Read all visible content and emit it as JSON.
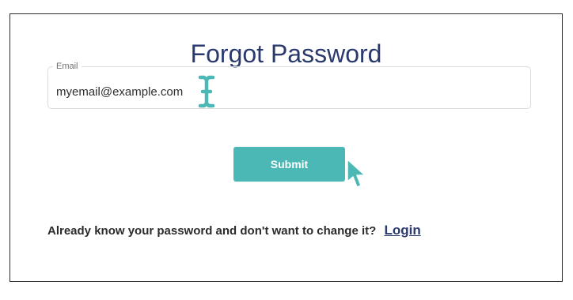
{
  "page": {
    "title": "Forgot Password"
  },
  "form": {
    "email_label": "Email",
    "email_value": "myemail@example.com",
    "submit_label": "Submit"
  },
  "footer": {
    "prompt_text": "Already know your password and don't want to change it?",
    "login_link_label": "Login"
  },
  "icons": {
    "text_cursor": "text-cursor-icon",
    "pointer": "mouse-pointer-icon"
  },
  "colors": {
    "title": "#2b3a6e",
    "accent": "#4bb8b5",
    "link": "#2b3a6e",
    "text": "#2b2b2b",
    "border": "#2b2b2b"
  }
}
